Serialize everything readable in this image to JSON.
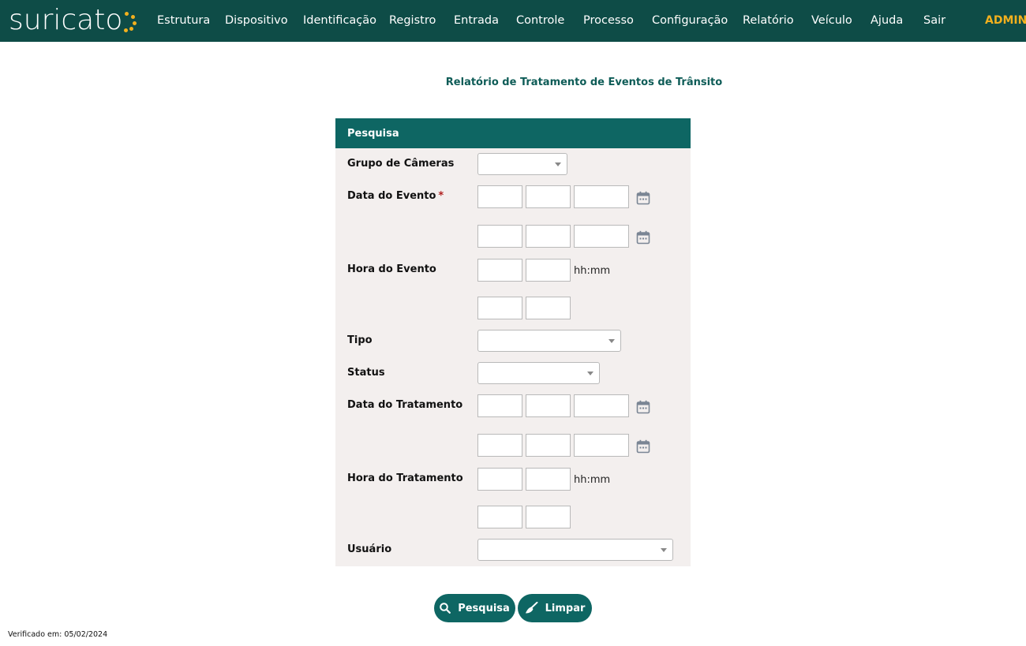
{
  "brand": {
    "name": "suricato"
  },
  "nav": {
    "items": [
      "Estrutura",
      "Dispositivo",
      "Identificação",
      "Registro",
      "Entrada",
      "Controle",
      "Processo",
      "Configuração",
      "Relatório",
      "Veículo",
      "Ajuda",
      "Sair"
    ],
    "user": "ADMIN"
  },
  "page": {
    "title": "Relatório de Tratamento de Eventos de Trânsito"
  },
  "panel": {
    "header": "Pesquisa",
    "labels": {
      "grupo": "Grupo de Câmeras",
      "data_evento": "Data do Evento",
      "required_mark": "*",
      "hora_evento": "Hora do Evento",
      "tipo": "Tipo",
      "status": "Status",
      "data_tratamento": "Data do Tratamento",
      "hora_tratamento": "Hora do Tratamento",
      "usuario": "Usuário"
    },
    "time_hint": "hh:mm"
  },
  "buttons": {
    "search": "Pesquisa",
    "clear": "Limpar"
  },
  "footer": {
    "verified": "Verificado em: 05/02/2024"
  },
  "colors": {
    "header_bg": "#0e4c47",
    "accent": "#0e6663",
    "admin": "#f2b01e",
    "panel_bg": "#f3efee"
  },
  "icons": [
    "calendar-icon",
    "search-icon",
    "broom-icon",
    "chevron-down-icon"
  ]
}
